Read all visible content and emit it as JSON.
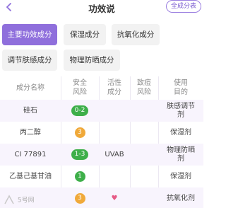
{
  "header": {
    "title": "功效说",
    "all_categories_label": "全成分表"
  },
  "tabs": [
    {
      "label": "主要功效成分",
      "active": true
    },
    {
      "label": "保湿成分",
      "active": false
    },
    {
      "label": "抗氧化成分",
      "active": false
    },
    {
      "label": "调节肤感成分",
      "active": false
    },
    {
      "label": "物理防晒成分",
      "active": false
    }
  ],
  "table": {
    "headers": {
      "name": "成分名称",
      "safety": "安全\n风险",
      "active": "活性\n成分",
      "acne": "致痘\n风险",
      "purpose": "使用\n目的"
    },
    "rows": [
      {
        "name": "硅石",
        "safety": "0-2",
        "safety_color": "green",
        "active": "",
        "acne": "",
        "purpose": "肤感调节\n剂"
      },
      {
        "name": "丙二醇",
        "safety": "3",
        "safety_color": "orange",
        "active": "",
        "acne": "",
        "purpose": "保湿剂"
      },
      {
        "name": "CI 77891",
        "safety": "1-3",
        "safety_color": "green",
        "active": "UVAB",
        "acne": "",
        "purpose": "物理防晒\n剂"
      },
      {
        "name": "乙基己基甘油",
        "safety": "1",
        "safety_color": "green",
        "active": "",
        "acne": "",
        "purpose": "保湿剂"
      },
      {
        "name": "",
        "safety": "3",
        "safety_color": "orange",
        "active": "heart",
        "acne": "",
        "purpose": "抗氧化剂"
      }
    ]
  },
  "watermark": "5号网",
  "colors": {
    "accent": "#8f6fdc",
    "green": "#3eaf4a",
    "orange": "#f0a93a",
    "heart": "#e65a86"
  }
}
